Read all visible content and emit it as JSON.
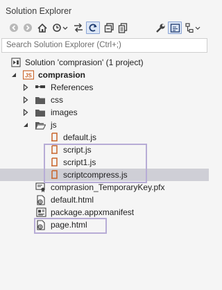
{
  "panel": {
    "title": "Solution Explorer"
  },
  "search": {
    "placeholder": "Search Solution Explorer (Ctrl+;)"
  },
  "toolbar": {
    "buttons": [
      {
        "icon": "back-icon"
      },
      {
        "icon": "forward-icon"
      },
      {
        "icon": "home-icon"
      },
      {
        "icon": "pending-changes-icon"
      },
      {
        "icon": "sync-icon"
      },
      {
        "icon": "refresh-icon"
      },
      {
        "icon": "collapse-all-icon"
      },
      {
        "icon": "show-all-files-icon"
      },
      {
        "icon": "properties-icon"
      },
      {
        "icon": "preview-icon"
      },
      {
        "icon": "class-view-icon"
      }
    ]
  },
  "tree": {
    "solution": "Solution 'comprasion' (1 project)",
    "project": "comprasion",
    "references": "References",
    "css": "css",
    "images": "images",
    "js": "js",
    "default_js": "default.js",
    "script_js": "script.js",
    "script1_js": "script1.js",
    "scriptcompress_js": "scriptcompress.js",
    "temporary_key": "comprasion_TemporaryKey.pfx",
    "default_html": "default.html",
    "manifest": "package.appxmanifest",
    "page_html": "page.html"
  },
  "colors": {
    "selection": "#cfcfd6",
    "highlight_box": "#b7acd6",
    "js_icon": "#c8642a",
    "folder_icon": "#5a5a5a"
  }
}
